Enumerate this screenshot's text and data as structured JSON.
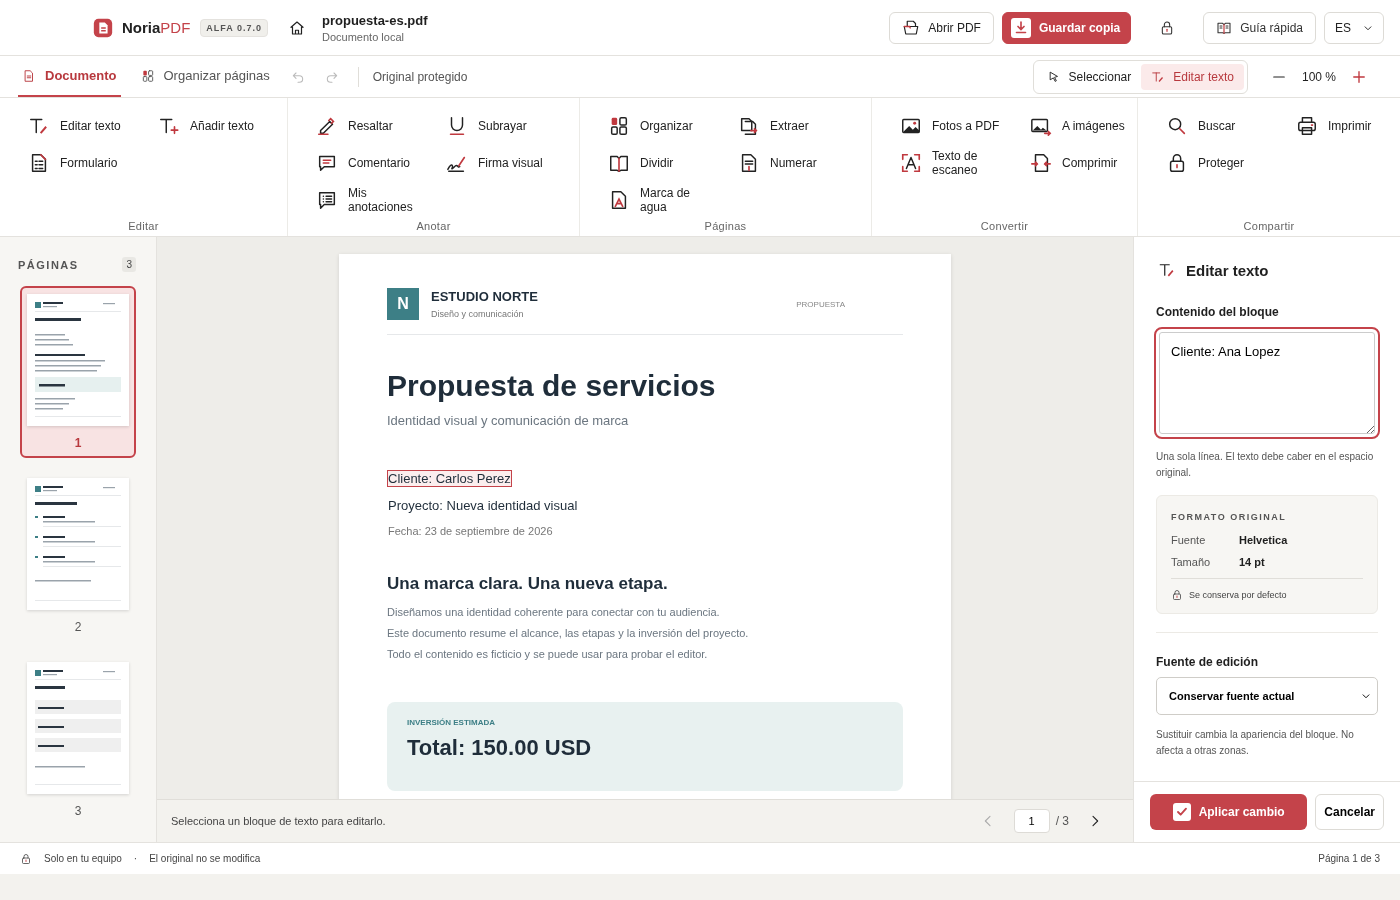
{
  "app": {
    "brand": {
      "name": "Noria",
      "accent": "PDF"
    },
    "version": "ALFA 0.7.0"
  },
  "file": {
    "name": "propuesta-es.pdf",
    "location": "Documento local"
  },
  "top_actions": [
    {
      "label": "Abrir PDF",
      "kind": "secondary"
    },
    {
      "label": "Guardar copia",
      "kind": "primary"
    }
  ],
  "guide_button": "Guía rápida",
  "language": "ES",
  "tabs": [
    {
      "label": "Documento",
      "selected": true
    },
    {
      "label": "Organizar páginas",
      "selected": false
    }
  ],
  "history": [
    {
      "kind": "undo",
      "disabled": true
    },
    {
      "kind": "redo",
      "disabled": true
    }
  ],
  "protection_note": "Original protegido",
  "modes": [
    {
      "label": "Seleccionar",
      "selected": false
    },
    {
      "label": "Editar texto",
      "selected": true
    }
  ],
  "zoom": "100 %",
  "ribbon": [
    {
      "label": "Editar",
      "items": [
        "Editar texto",
        "Añadir texto",
        "Formulario"
      ]
    },
    {
      "label": "Anotar",
      "items": [
        "Resaltar",
        "Subrayar",
        "Comentario",
        "Firma visual",
        "Mis anotaciones"
      ]
    },
    {
      "label": "Páginas",
      "items": [
        "Organizar",
        "Extraer",
        "Dividir",
        "Numerar",
        "Marca de agua"
      ]
    },
    {
      "label": "Convertir",
      "items": [
        "Fotos a PDF",
        "A imágenes",
        "Texto de escaneo",
        "Comprimir"
      ]
    },
    {
      "label": "Compartir",
      "items": [
        "Buscar",
        "Imprimir",
        "Proteger"
      ]
    }
  ],
  "pages_panel": {
    "title": "PÁGINAS",
    "count": "3",
    "pages": [
      {
        "number": "1",
        "selected": true
      },
      {
        "number": "2",
        "selected": false
      },
      {
        "number": "3",
        "selected": false
      }
    ]
  },
  "document": {
    "logo_letter": "N",
    "company": "ESTUDIO NORTE",
    "tagline": "Diseño y comunicación",
    "doc_type": "PROPUESTA",
    "title": "Propuesta de servicios",
    "subtitle": "Identidad visual y comunicación de marca",
    "fields": [
      {
        "text": "Cliente: Carlos Perez",
        "kind": "primary",
        "selected": true
      },
      {
        "text": "Proyecto: Nueva identidad visual",
        "kind": "primary",
        "selected": false
      },
      {
        "text": "Fecha: 23 de septiembre de 2026",
        "kind": "muted",
        "selected": false
      }
    ],
    "heading": "Una marca clara. Una nueva etapa.",
    "paragraphs": [
      "Diseñamos una identidad coherente para conectar con tu audiencia.",
      "Este documento resume el alcance, las etapas y la inversión del proyecto.",
      "Todo el contenido es ficticio y se puede usar para probar el editor."
    ],
    "estimate": {
      "label": "INVERSIÓN ESTIMADA",
      "total": "Total: 150.00 USD"
    }
  },
  "status": {
    "hint": "Selecciona un bloque de texto para editarlo.",
    "page": "1",
    "total": "/ 3",
    "prev_disabled": true,
    "next_disabled": false
  },
  "editor": {
    "title": "Editar texto",
    "content_label": "Contenido del bloque",
    "content": "Cliente: Ana Lopez",
    "content_hint": "Una sola línea. El texto debe caber en el espacio original.",
    "format": {
      "title": "FORMATO ORIGINAL",
      "rows": [
        {
          "label": "Fuente",
          "value": "Helvetica"
        },
        {
          "label": "Tamaño",
          "value": "14 pt"
        }
      ],
      "note": "Se conserva por defecto"
    },
    "font_label": "Fuente de edición",
    "font_choice": "Conservar fuente actual",
    "font_hint": "Sustituir cambia la apariencia del bloque. No afecta a otras zonas.",
    "apply": "Aplicar cambio",
    "cancel": "Cancelar"
  },
  "footer": {
    "items": [
      "Solo en tu equipo",
      "·",
      "El original no se modifica"
    ],
    "page_info": "Página 1 de 3"
  }
}
